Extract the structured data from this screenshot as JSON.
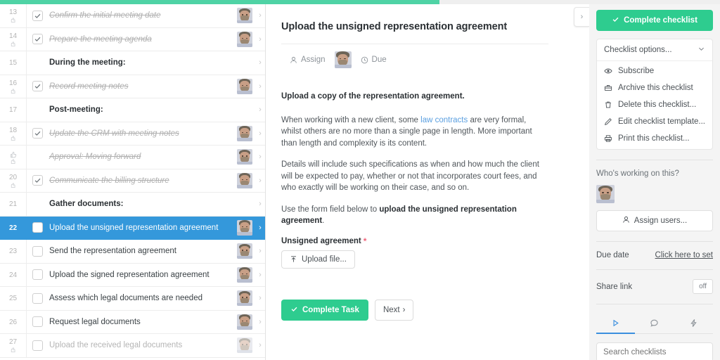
{
  "progress": {
    "percent": 61,
    "color": "#4fd3a5"
  },
  "colors": {
    "accent_green": "#2ecc8f",
    "selected_blue": "#3498db",
    "link_blue": "#5a9fe0",
    "required_red": "#f0647a"
  },
  "sidebar": {
    "items": [
      {
        "num": "13",
        "label": "Confirm the initial meeting date",
        "type": "task",
        "checked": true,
        "done": true,
        "avatar": true,
        "stop_icon": true
      },
      {
        "num": "14",
        "label": "Prepare the meeting agenda",
        "type": "task",
        "checked": true,
        "done": true,
        "avatar": true,
        "stop_icon": true
      },
      {
        "num": "15",
        "label": "During the meeting:",
        "type": "heading",
        "checked": false,
        "done": false,
        "avatar": false,
        "stop_icon": false
      },
      {
        "num": "16",
        "label": "Record meeting notes",
        "type": "task",
        "checked": true,
        "done": true,
        "avatar": true,
        "stop_icon": true
      },
      {
        "num": "17",
        "label": "Post-meeting:",
        "type": "heading",
        "checked": false,
        "done": false,
        "avatar": false,
        "stop_icon": false
      },
      {
        "num": "18",
        "label": "Update the CRM with meeting notes",
        "type": "task",
        "checked": true,
        "done": true,
        "avatar": true,
        "stop_icon": true
      },
      {
        "num": "",
        "label": "Approval: Moving forward",
        "type": "approval",
        "checked": false,
        "done": true,
        "avatar": true,
        "stop_icon": true
      },
      {
        "num": "20",
        "label": "Communicate the billing structure",
        "type": "task",
        "checked": true,
        "done": true,
        "avatar": true,
        "stop_icon": true
      },
      {
        "num": "21",
        "label": "Gather documents:",
        "type": "heading",
        "checked": false,
        "done": false,
        "avatar": false,
        "stop_icon": false
      },
      {
        "num": "22",
        "label": "Upload the unsigned representation agreement",
        "type": "task",
        "checked": false,
        "done": false,
        "avatar": true,
        "stop_icon": false,
        "selected": true
      },
      {
        "num": "23",
        "label": "Send the representation agreement",
        "type": "task",
        "checked": false,
        "done": false,
        "avatar": true,
        "stop_icon": false
      },
      {
        "num": "24",
        "label": "Upload the signed representation agreement",
        "type": "task",
        "checked": false,
        "done": false,
        "avatar": true,
        "stop_icon": false
      },
      {
        "num": "25",
        "label": "Assess which legal documents are needed",
        "type": "task",
        "checked": false,
        "done": false,
        "avatar": true,
        "stop_icon": false
      },
      {
        "num": "26",
        "label": "Request legal documents",
        "type": "task",
        "checked": false,
        "done": false,
        "avatar": true,
        "stop_icon": false
      },
      {
        "num": "27",
        "label": "Upload the received legal documents",
        "type": "task",
        "checked": false,
        "done": false,
        "avatar": true,
        "stop_icon": true,
        "muted": true
      }
    ]
  },
  "main": {
    "title": "Upload the unsigned representation agreement",
    "assign_label": "Assign",
    "due_label": "Due",
    "lead": "Upload a copy of the representation agreement.",
    "para1_a": "When working with a new client, some ",
    "para1_link": "law contracts",
    "para1_b": " are very formal, whilst others are no more than a single page in length. More important than length and complexity is its content.",
    "para2": "Details will include such specifications as when and how much the client will be expected to pay, whether or not that incorporates court fees, and who exactly will be working on their case, and so on.",
    "para3_a": "Use the form field below to ",
    "para3_b": "upload the unsigned representation agreement",
    "para3_c": ".",
    "field_label": "Unsigned agreement",
    "required_marker": "*",
    "upload_button": "Upload file...",
    "complete_task_button": "Complete Task",
    "next_button": "Next",
    "collapse_icon": "chevron-right-icon"
  },
  "rightbar": {
    "complete_checklist_button": "Complete checklist",
    "options_label": "Checklist options...",
    "menu": [
      {
        "label": "Subscribe",
        "icon": "eye-icon"
      },
      {
        "label": "Archive this checklist",
        "icon": "archive-icon"
      },
      {
        "label": "Delete this checklist...",
        "icon": "trash-icon"
      },
      {
        "label": "Edit checklist template...",
        "icon": "pencil-icon"
      },
      {
        "label": "Print this checklist...",
        "icon": "printer-icon"
      }
    ],
    "working_title": "Who's working on this?",
    "assign_users_button": "Assign users...",
    "due_date_label": "Due date",
    "due_date_link": "Click here to set",
    "share_link_label": "Share link",
    "share_link_toggle": "off",
    "tabs": [
      {
        "name": "activity",
        "icon": "play-icon",
        "active": true
      },
      {
        "name": "comments",
        "icon": "comment-icon",
        "active": false
      },
      {
        "name": "automations",
        "icon": "lightning-icon",
        "active": false
      }
    ],
    "search_placeholder": "Search checklists"
  }
}
